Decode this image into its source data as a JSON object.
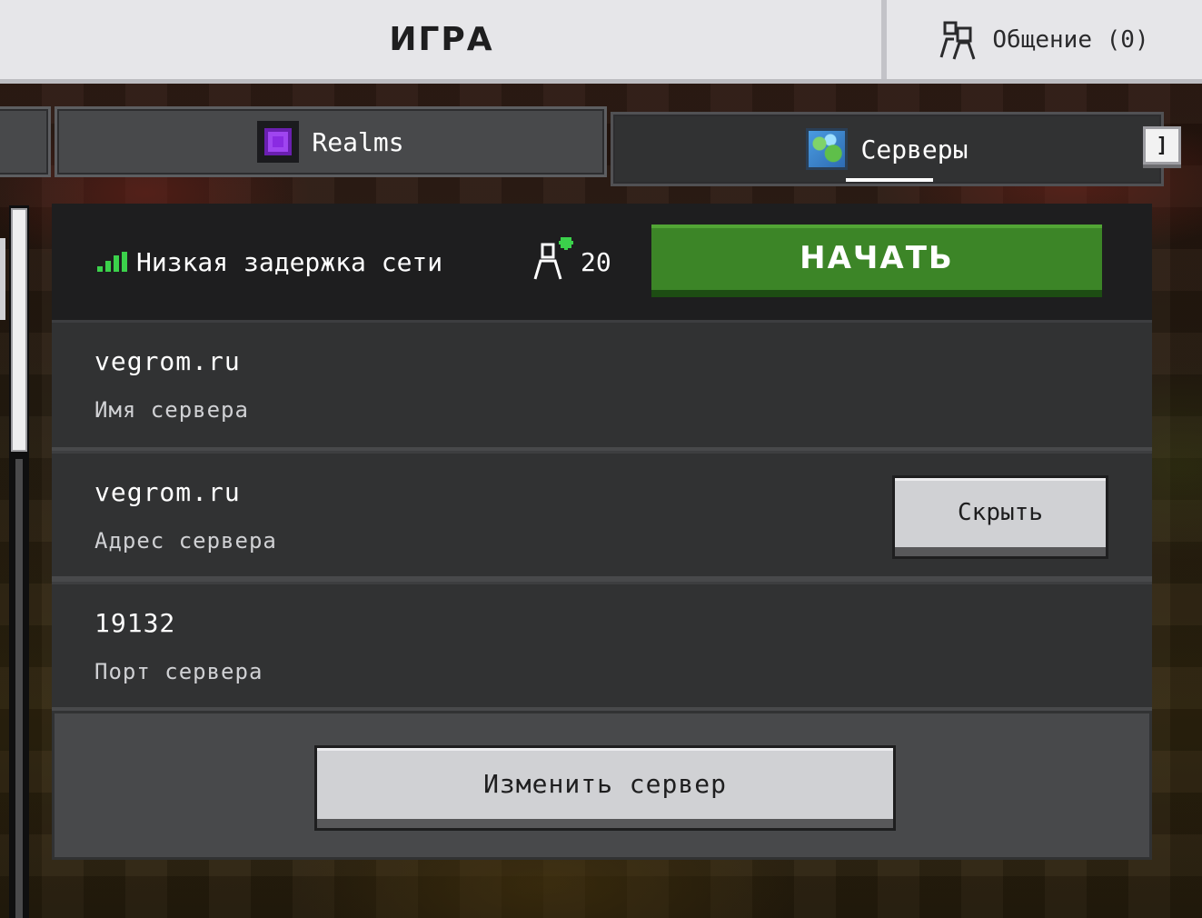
{
  "header": {
    "title": "ИГРА",
    "social_label": "Общение (0)",
    "social_icon": "friends-icon"
  },
  "tabs": [
    {
      "label": "",
      "active": false
    },
    {
      "label": "Realms",
      "icon": "realms-icon",
      "active": false
    },
    {
      "label": "Серверы",
      "icon": "globe-icon",
      "active": true
    }
  ],
  "key_hint": "]",
  "server": {
    "latency_label": "Низкая задержка сети",
    "latency_icon": "signal-bars-icon",
    "player_count": "20",
    "players_icon": "add-players-icon",
    "play_button": "НАЧАТЬ",
    "fields": [
      {
        "value": "vegrom.ru",
        "label": "Имя сервера"
      },
      {
        "value": "vegrom.ru",
        "label": "Адрес сервера",
        "action": "Скрыть"
      },
      {
        "value": "19132",
        "label": "Порт сервера"
      }
    ],
    "edit_button": "Изменить сервер"
  },
  "colors": {
    "play_green": "#3c8527",
    "signal_green": "#3bd14b",
    "panel_dark": "#313233",
    "header_bg": "#e6e6e9"
  }
}
